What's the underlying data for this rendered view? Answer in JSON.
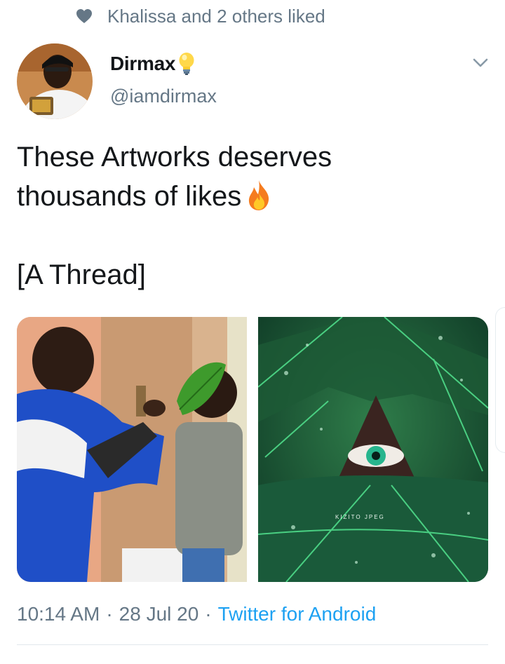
{
  "social_context": {
    "icon": "heart-icon",
    "text": "Khalissa and 2 others liked"
  },
  "author": {
    "display_name": "Dirmax",
    "name_emoji": "bulb-icon",
    "handle": "@iamdirmax"
  },
  "tweet": {
    "line1": "These Artworks deserves",
    "line2": "thousands of likes",
    "line2_emoji": "fire-icon",
    "line3": "[A Thread]"
  },
  "media": [
    {
      "name": "photo-leaf-over-face",
      "description_icon": "photo-icon"
    },
    {
      "name": "photo-eye-through-leaf",
      "watermark": "KIZITO  JPEG"
    }
  ],
  "meta": {
    "time": "10:14 AM",
    "separator": "·",
    "date": "28 Jul 20",
    "source": "Twitter for Android"
  },
  "colors": {
    "text_primary": "#14171a",
    "text_secondary": "#657786",
    "link": "#1da1f2",
    "divider": "#e1e8ed"
  }
}
